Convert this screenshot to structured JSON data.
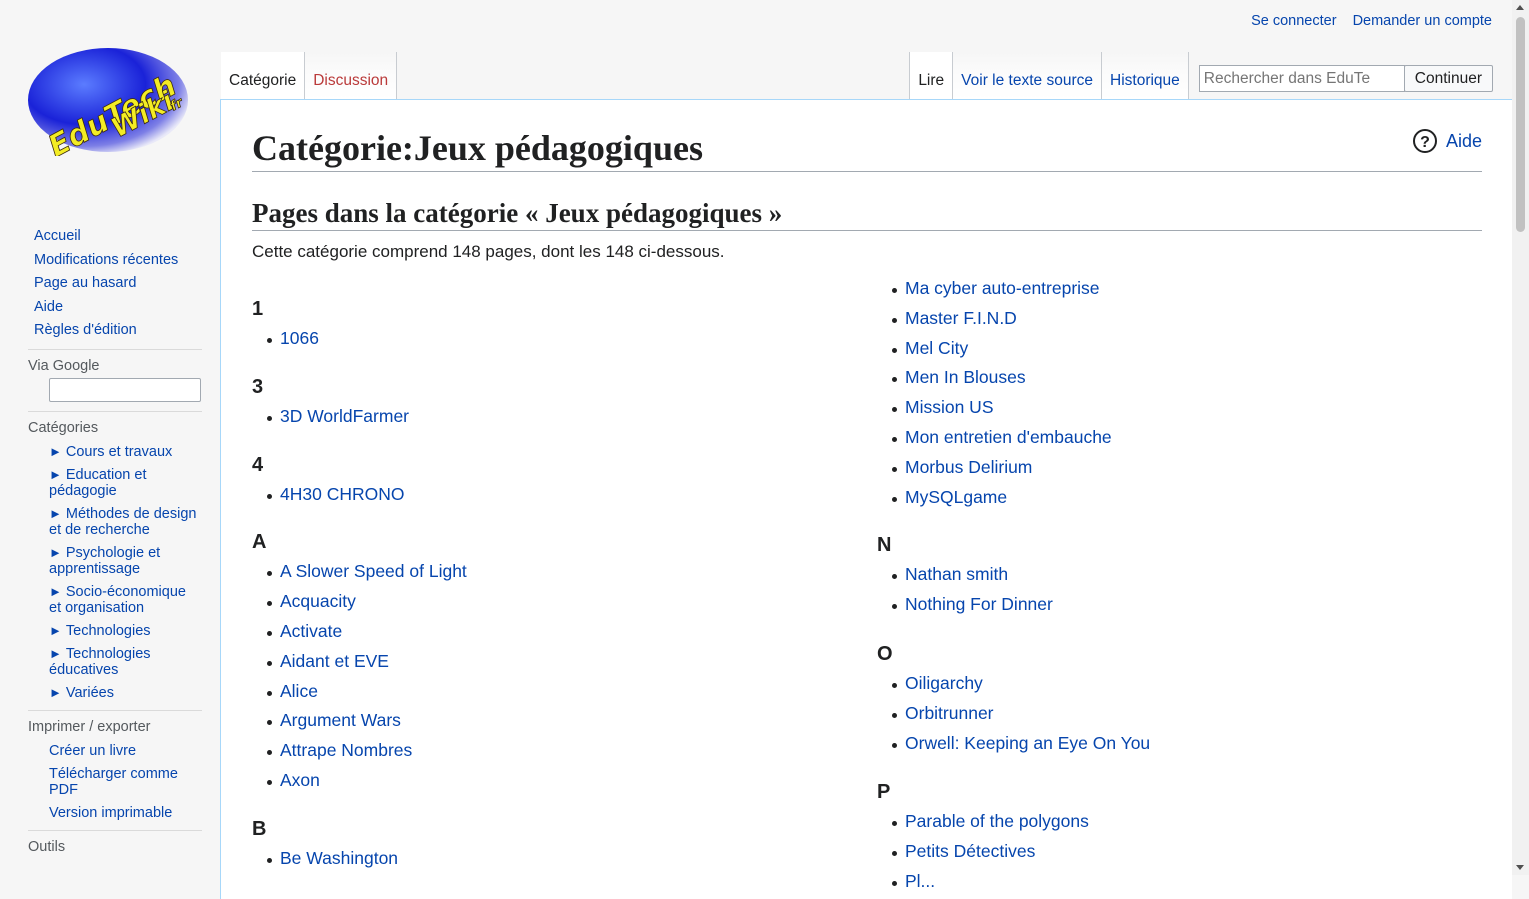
{
  "personal": {
    "login": "Se connecter",
    "create_account": "Demander un compte"
  },
  "logo": {
    "line1": "EduTech",
    "line2": "Wiki",
    "suffix": "fr"
  },
  "sidebar": {
    "nav": [
      "Accueil",
      "Modifications récentes",
      "Page au hasard",
      "Aide",
      "Règles d'édition"
    ],
    "google": {
      "heading": "Via Google"
    },
    "categories": {
      "heading": "Catégories",
      "items": [
        "Cours et travaux",
        "Education et pédagogie",
        "Méthodes de design et de recherche",
        "Psychologie et apprentissage",
        "Socio-économique et organisation",
        "Technologies",
        "Technologies éducatives",
        "Variées"
      ]
    },
    "print": {
      "heading": "Imprimer / exporter",
      "items": [
        "Créer un livre",
        "Télécharger comme PDF",
        "Version imprimable"
      ]
    },
    "tools": {
      "heading": "Outils"
    }
  },
  "tabs": {
    "left": [
      "Catégorie",
      "Discussion"
    ],
    "right": [
      "Lire",
      "Voir le texte source",
      "Historique"
    ]
  },
  "search": {
    "placeholder": "Rechercher dans EduTe",
    "button": "Continuer"
  },
  "page": {
    "title": "Catégorie:Jeux pédagogiques",
    "help": "Aide",
    "section_title": "Pages dans la catégorie « Jeux pédagogiques »",
    "summary": "Cette catégorie comprend 148 pages, dont les 148 ci-dessous."
  },
  "column1": [
    {
      "letter": "1",
      "items": [
        "1066"
      ]
    },
    {
      "letter": "3",
      "items": [
        "3D WorldFarmer"
      ]
    },
    {
      "letter": "4",
      "items": [
        "4H30 CHRONO"
      ]
    },
    {
      "letter": "A",
      "items": [
        "A Slower Speed of Light",
        "Acquacity",
        "Activate",
        "Aidant et EVE",
        "Alice",
        "Argument Wars",
        "Attrape Nombres",
        "Axon"
      ]
    },
    {
      "letter": "B",
      "items": [
        "Be Washington"
      ]
    }
  ],
  "column2_continued": [
    "Ma cyber auto-entreprise",
    "Master F.I.N.D",
    "Mel City",
    "Men In Blouses",
    "Mission US",
    "Mon entretien d'embauche",
    "Morbus Delirium",
    "MySQLgame"
  ],
  "column2": [
    {
      "letter": "N",
      "items": [
        "Nathan smith",
        "Nothing For Dinner"
      ]
    },
    {
      "letter": "O",
      "items": [
        "Oiligarchy",
        "Orbitrunner",
        "Orwell: Keeping an Eye On You"
      ]
    },
    {
      "letter": "P",
      "items": [
        "Parable of the polygons",
        "Petits Détectives",
        "Pl..."
      ]
    }
  ]
}
